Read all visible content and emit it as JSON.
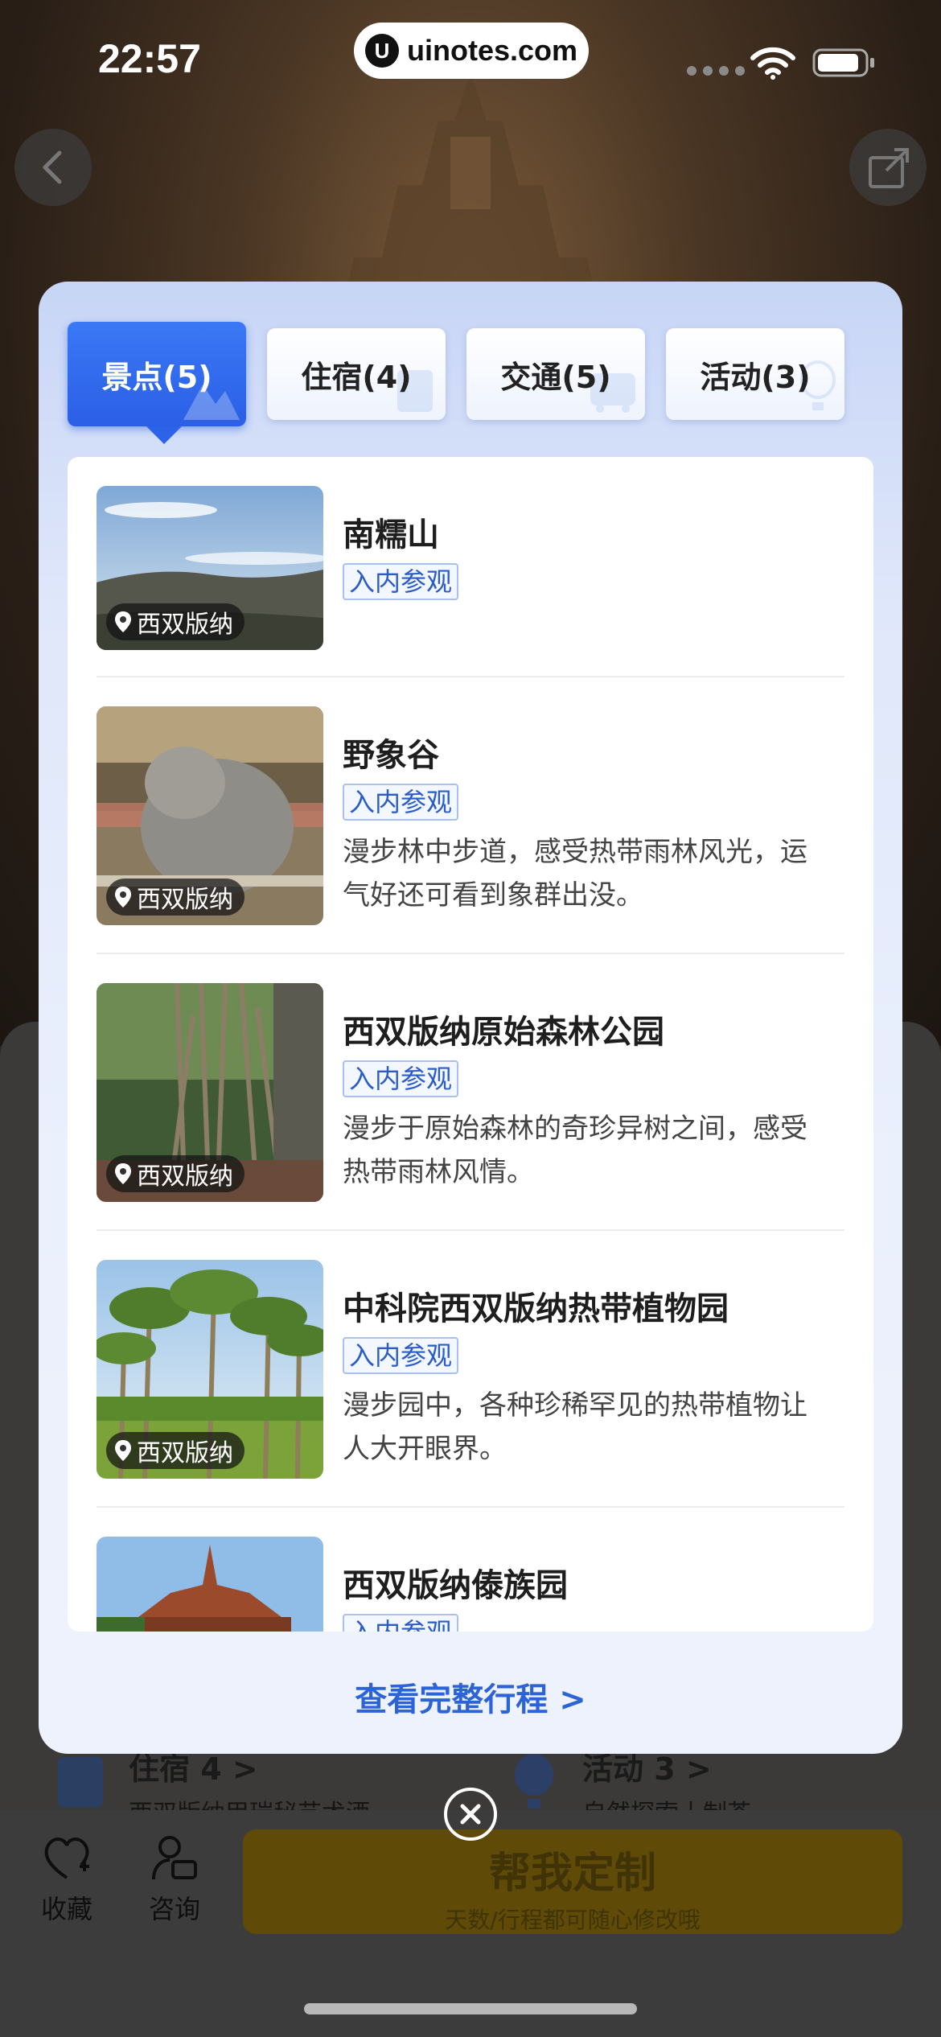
{
  "status_bar": {
    "time": "22:57",
    "url": "uinotes.com"
  },
  "background": {
    "stay_label": "住宿 4",
    "stay_sub": "西双版纳甲瑞秘艺术酒",
    "activity_label": "活动 3",
    "activity_sub": "自然探索丨制茶",
    "favorite_label": "收藏",
    "consult_label": "咨询",
    "customize_label": "帮我定制",
    "customize_sub": "天数/行程都可随心修改哦"
  },
  "tabs": [
    {
      "label": "景点(5)",
      "active": true
    },
    {
      "label": "住宿(4)",
      "active": false
    },
    {
      "label": "交通(5)",
      "active": false
    },
    {
      "label": "活动(3)",
      "active": false
    }
  ],
  "items": [
    {
      "title": "南糯山",
      "tag": "入内参观",
      "location": "西双版纳",
      "desc": ""
    },
    {
      "title": "野象谷",
      "tag": "入内参观",
      "location": "西双版纳",
      "desc": "漫步林中步道，感受热带雨林风光，运气好还可看到象群出没。"
    },
    {
      "title": "西双版纳原始森林公园",
      "tag": "入内参观",
      "location": "西双版纳",
      "desc": "漫步于原始森林的奇珍异树之间，感受热带雨林风情。"
    },
    {
      "title": "中科院西双版纳热带植物园",
      "tag": "入内参观",
      "location": "西双版纳",
      "desc": "漫步园中，各种珍稀罕见的热带植物让人大开眼界。"
    },
    {
      "title": "西双版纳傣族园",
      "tag": "入内参观",
      "location": "",
      "desc": ""
    }
  ],
  "view_full_label": "查看完整行程 >",
  "colors": {
    "accent": "#2b5fe6",
    "link": "#2c63d6",
    "tag_text": "#2b5cc9"
  }
}
